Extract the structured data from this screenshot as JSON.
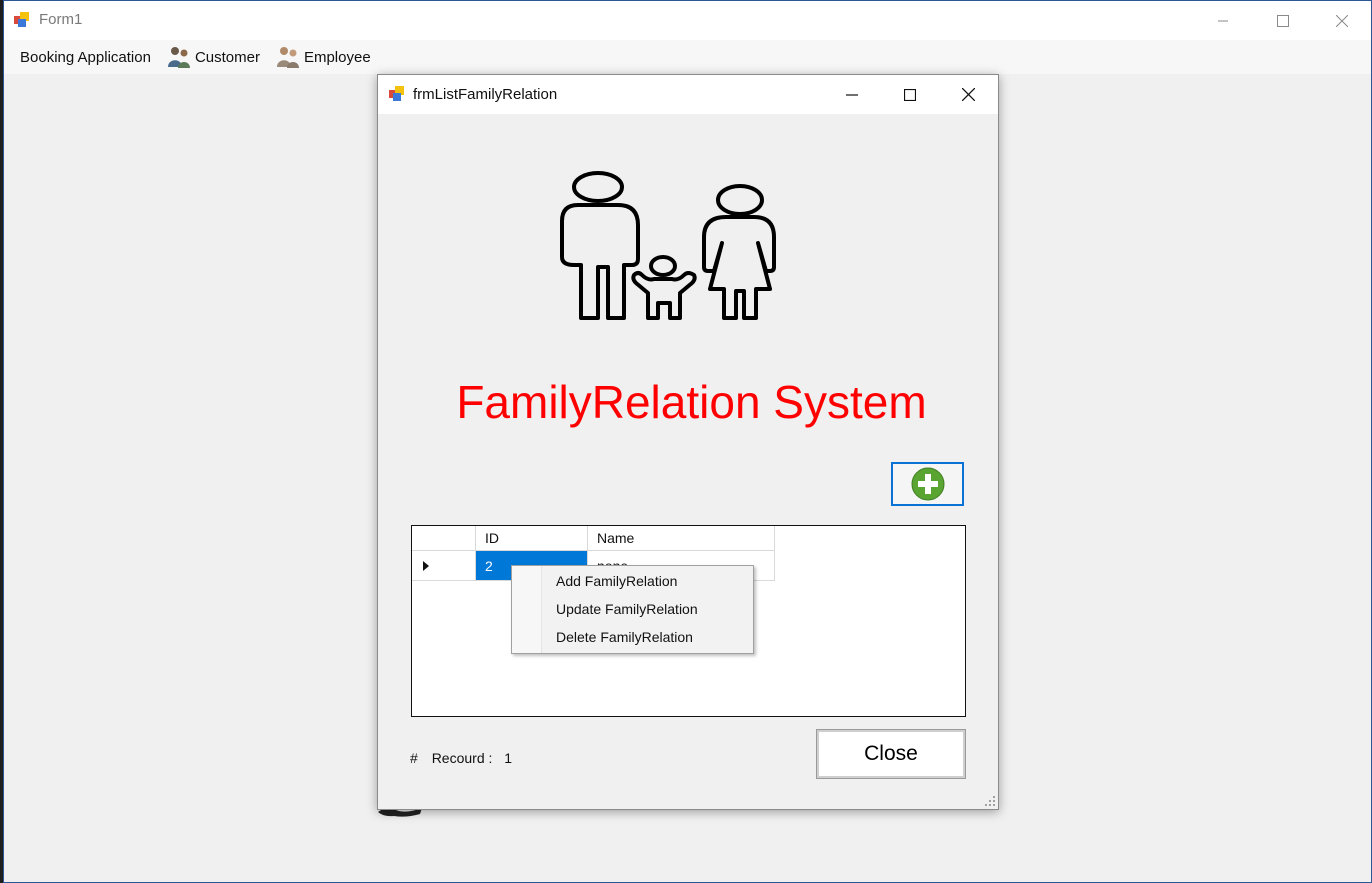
{
  "main_window": {
    "title": "Form1",
    "menu": [
      "Booking Application",
      "Customer",
      "Employee"
    ]
  },
  "child_window": {
    "title": "frmListFamilyRelation",
    "heading": "FamilyRelation System",
    "grid": {
      "columns": [
        "ID",
        "Name"
      ],
      "rows": [
        {
          "id": "2",
          "name": "none"
        }
      ]
    },
    "context_menu": [
      "Add FamilyRelation",
      "Update FamilyRelation",
      "Delete FamilyRelation"
    ],
    "record_prefix": "#",
    "record_label": "Recourd :",
    "record_count": "1",
    "close_label": "Close"
  },
  "icons": {
    "app": "winforms-app-icon",
    "add": "plus-circle-icon",
    "logo": "family-icon"
  },
  "colors": {
    "heading": "#ff0000",
    "selection": "#0078d7",
    "add_icon": "#5aa532"
  }
}
